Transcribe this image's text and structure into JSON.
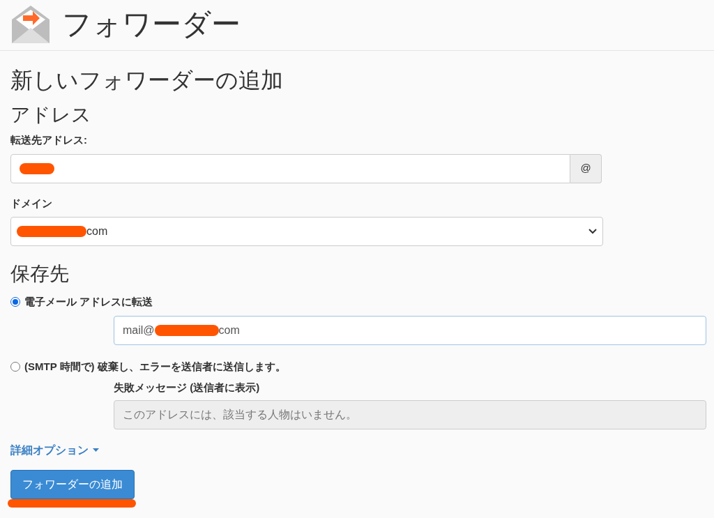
{
  "page_title": "フォワーダー",
  "form_title": "新しいフォワーダーの追加",
  "address_section": {
    "heading": "アドレス",
    "forward_label": "転送先アドレス:",
    "forward_field": {
      "redacted": true
    },
    "addon": "@",
    "domain_label": "ドメイン",
    "domain_select": {
      "redacted": true,
      "visible_parts": [
        "com"
      ]
    }
  },
  "destination_section": {
    "heading": "保存先",
    "options": [
      {
        "kind": "email",
        "label": "電子メール アドレスに転送",
        "selected": true,
        "field": {
          "redacted": true,
          "visible_parts": [
            "mail@",
            "com"
          ]
        }
      },
      {
        "kind": "fail",
        "label": "(SMTP 時間で) 破棄し、エラーを送信者に送信します。",
        "selected": false,
        "sub_label": "失敗メッセージ (送信者に表示)",
        "field": {
          "placeholder": "このアドレスには、該当する人物はいません。",
          "disabled": true
        }
      }
    ]
  },
  "advanced_link": "詳細オプション",
  "submit_button": {
    "label": "フォワーダーの追加",
    "underlined": true
  }
}
